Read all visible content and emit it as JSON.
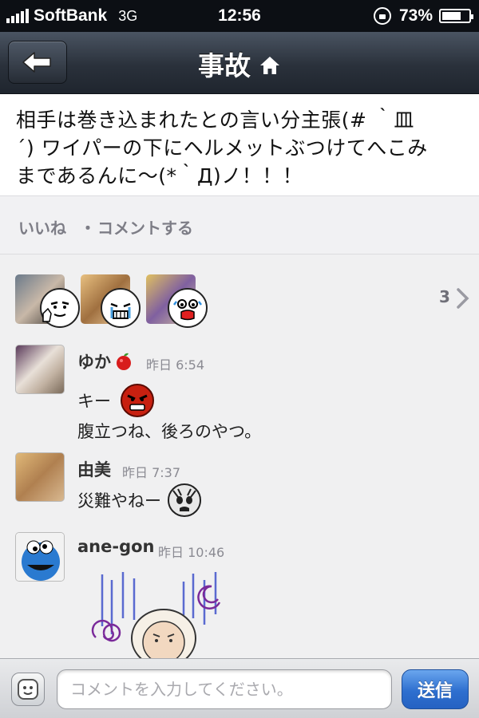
{
  "status_bar": {
    "carrier": "SoftBank",
    "network": "3G",
    "time": "12:56",
    "battery": "73%",
    "battery_level": 0.73
  },
  "nav": {
    "title": "事故",
    "back_icon": "back-arrow-icon",
    "title_icon": "home-icon"
  },
  "post": {
    "lines": [
      "相手は巻き込まれたとの言い分主張(# ｀皿",
      "´) ワイパーの下にヘルメットぶつけてへこみ",
      "まであるんに〜(*｀Д)ノ！！！"
    ]
  },
  "actions": {
    "like": "いいね",
    "separator": "・",
    "comment": "コメントする"
  },
  "likes": {
    "count": "3"
  },
  "comments": [
    {
      "name": "ゆか",
      "time": "昨日 6:54",
      "lines": [
        "キー",
        "腹立つね、後ろのやつ。"
      ]
    },
    {
      "name": "由美",
      "time": "昨日 7:37",
      "lines": [
        "災難やねー"
      ]
    },
    {
      "name": "ane-gon",
      "time": "昨日 10:46",
      "lines": []
    }
  ],
  "composer": {
    "placeholder": "コメントを入力してください。",
    "send": "送信"
  },
  "colors": {
    "nav_bg": "#2a313b",
    "send_button": "#2e6fcf",
    "text_muted": "#7d7d86"
  }
}
